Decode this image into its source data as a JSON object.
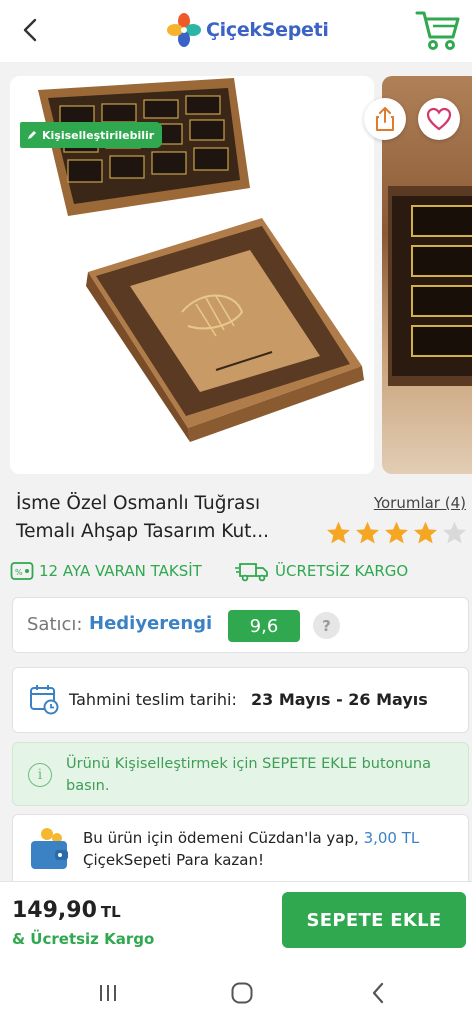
{
  "header": {
    "logo_text": "ÇiçekSepeti",
    "back_icon": "chevron-left-icon",
    "cart_icon": "shopping-cart-icon"
  },
  "gallery": {
    "badge_label": "Kişiselleştirilebilir",
    "share_icon": "share-icon",
    "favorite_icon": "heart-icon"
  },
  "product": {
    "title": "İsme Özel Osmanlı Tuğrası Temalı Ahşap Tasarım Kut...",
    "reviews_label": "Yorumlar (4)",
    "rating": 4,
    "rating_max": 5
  },
  "perks": {
    "installment": "12 AYA VARAN TAKSİT",
    "free_cargo": "ÜCRETSİZ KARGO"
  },
  "seller": {
    "label": "Satıcı:",
    "name": "Hediyerengi",
    "score": "9,6",
    "help": "?"
  },
  "delivery": {
    "label": "Tahmini teslim tarihi:",
    "dates": "23 Mayıs - 26 Mayıs"
  },
  "info": {
    "icon_glyph": "i",
    "text": "Ürünü Kişiselleştirmek için SEPETE EKLE butonuna basın."
  },
  "wallet": {
    "text_before": "Bu ürün için ödemeni Cüzdan'la yap,",
    "amount": "3,00 TL",
    "text_after": "ÇiçekSepeti Para kazan!"
  },
  "bottom": {
    "price": "149,90",
    "currency": "TL",
    "shipping_note": "& Ücretsiz Kargo",
    "add_to_cart": "SEPETE EKLE"
  },
  "colors": {
    "green": "#2fa84f",
    "blue": "#3b82c4",
    "star": "#f5a623"
  }
}
